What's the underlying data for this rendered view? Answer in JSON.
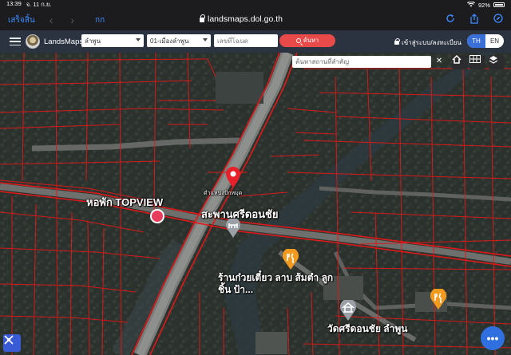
{
  "status_bar": {
    "time": "13:39",
    "date": "จ. 11 ก.ย.",
    "battery": "92%"
  },
  "safari": {
    "done_label": "เสร็จสิ้น",
    "reader_label": "กก",
    "url": "landsmaps.dol.go.th"
  },
  "header": {
    "brand": "LandsMaps",
    "province": "ลำพูน",
    "district": "01-เมืองลำพูน",
    "deed_placeholder": "เลขที่โฉนด",
    "search_label": "ค้นหา",
    "login_label": "เข้าสู่ระบบ/ลงทะเบียน",
    "lang_th": "TH",
    "lang_en": "EN"
  },
  "map": {
    "place_search_placeholder": "ค้นหาสถานที่สำคัญ",
    "pin_label": "ตำแหน่งปักหมุด",
    "labels": {
      "hotel": "หอพัก TOPVIEW",
      "bridge": "สะพานศรีดอนชัย",
      "restaurant": "ร้านก๋วยเตี๋ยว ลาบ ส้มตำ ลูกชิ้น ป้า...",
      "temple": "วัดศรีดอนชัย ลำพูน"
    },
    "fab_label": "•••"
  },
  "colors": {
    "parcel_line": "#e01818",
    "accent_blue": "#3a6fd8",
    "search_red": "#e84a4a",
    "header_bg": "#2b3340"
  }
}
